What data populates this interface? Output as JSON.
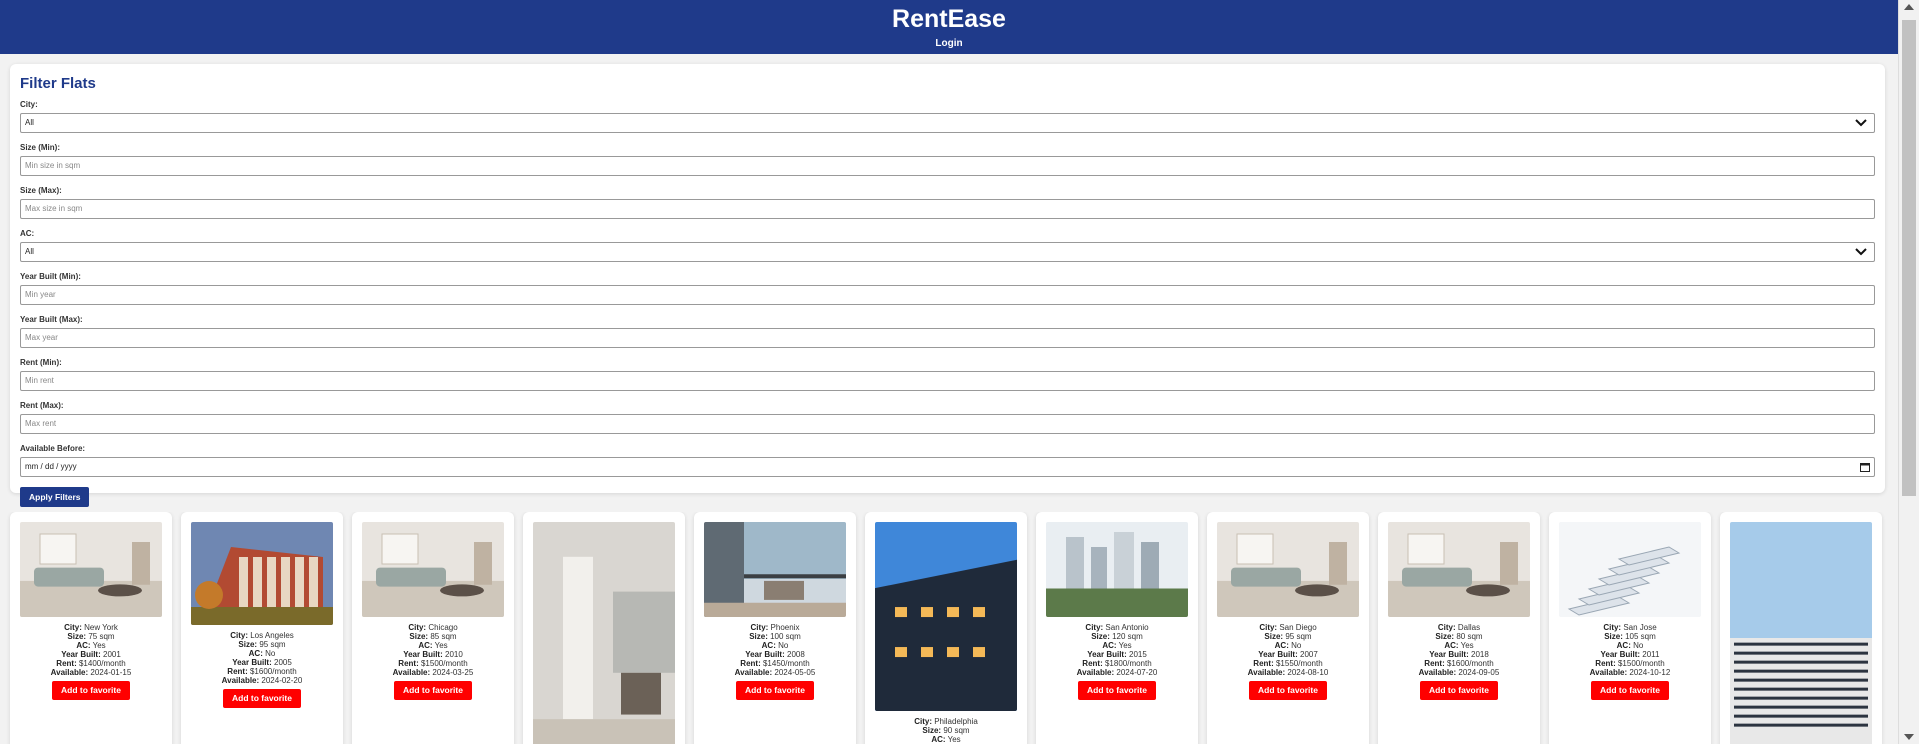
{
  "header": {
    "title": "RentEase",
    "login": "Login"
  },
  "filters": {
    "title": "Filter Flats",
    "city": {
      "label": "City:",
      "value": "All"
    },
    "size_min": {
      "label": "Size (Min):",
      "placeholder": "Min size in sqm"
    },
    "size_max": {
      "label": "Size (Max):",
      "placeholder": "Max size in sqm"
    },
    "ac": {
      "label": "AC:",
      "value": "All"
    },
    "year_min": {
      "label": "Year Built (Min):",
      "placeholder": "Min year"
    },
    "year_max": {
      "label": "Year Built (Max):",
      "placeholder": "Max year"
    },
    "rent_min": {
      "label": "Rent (Min):",
      "placeholder": "Min rent"
    },
    "rent_max": {
      "label": "Rent (Max):",
      "placeholder": "Max rent"
    },
    "available_before": {
      "label": "Available Before:",
      "placeholder": "mm / dd / yyyy"
    },
    "apply": "Apply Filters"
  },
  "field_labels": {
    "city": "City:",
    "size": "Size:",
    "ac": "AC:",
    "year": "Year Built:",
    "rent": "Rent:",
    "available": "Available:"
  },
  "favorite_label": "Add to favorite",
  "flats": [
    {
      "city": "New York",
      "size": "75 sqm",
      "ac": "Yes",
      "year": "2001",
      "rent": "$1400/month",
      "available": "2024-01-15",
      "photo": "living-room"
    },
    {
      "city": "Los Angeles",
      "size": "95 sqm",
      "ac": "No",
      "year": "2005",
      "rent": "$1600/month",
      "available": "2024-02-20",
      "photo": "apartment-building"
    },
    {
      "city": "Chicago",
      "size": "85 sqm",
      "ac": "Yes",
      "year": "2010",
      "rent": "$1500/month",
      "available": "2024-03-25",
      "photo": "living-room"
    },
    {
      "city": "",
      "size": "",
      "ac": "",
      "year": "",
      "rent": "",
      "available": "",
      "photo": "interior"
    },
    {
      "city": "Phoenix",
      "size": "100 sqm",
      "ac": "No",
      "year": "2008",
      "rent": "$1450/month",
      "available": "2024-05-05",
      "photo": "balcony"
    },
    {
      "city": "Philadelphia",
      "size": "90 sqm",
      "ac": "Yes",
      "year": "",
      "rent": "",
      "available": "",
      "photo": "tower"
    },
    {
      "city": "San Antonio",
      "size": "120 sqm",
      "ac": "Yes",
      "year": "2015",
      "rent": "$1800/month",
      "available": "2024-07-20",
      "photo": "skyline"
    },
    {
      "city": "San Diego",
      "size": "95 sqm",
      "ac": "No",
      "year": "2007",
      "rent": "$1550/month",
      "available": "2024-08-10",
      "photo": "living-room"
    },
    {
      "city": "Dallas",
      "size": "80 sqm",
      "ac": "Yes",
      "year": "2018",
      "rent": "$1600/month",
      "available": "2024-09-05",
      "photo": "living-room"
    },
    {
      "city": "San Jose",
      "size": "105 sqm",
      "ac": "No",
      "year": "2011",
      "rent": "$1500/month",
      "available": "2024-10-12",
      "photo": "white-building"
    },
    {
      "city": "",
      "size": "",
      "ac": "",
      "year": "",
      "rent": "",
      "available": "",
      "photo": "blue-sky-building"
    }
  ],
  "colors": {
    "primary": "#1f3a8a",
    "favorite": "#ff0000"
  }
}
